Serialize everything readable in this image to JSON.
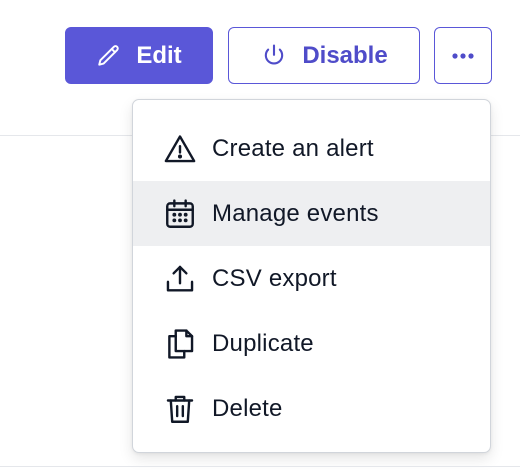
{
  "toolbar": {
    "edit_label": "Edit",
    "disable_label": "Disable",
    "more_label": "•••",
    "edit_icon": "pencil-icon",
    "disable_icon": "power-icon"
  },
  "menu": {
    "hovered_item": "Manage events",
    "items": [
      {
        "label": "Create an alert",
        "icon": "warning-triangle-icon"
      },
      {
        "label": "Manage events",
        "icon": "calendar-icon"
      },
      {
        "label": "CSV export",
        "icon": "upload-icon"
      },
      {
        "label": "Duplicate",
        "icon": "duplicate-icon"
      },
      {
        "label": "Delete",
        "icon": "trash-icon"
      }
    ]
  },
  "colors": {
    "primary": "#5a57d8",
    "primary_text": "#4f4cc9",
    "hover_bg": "#eeeff1",
    "text": "#111827"
  }
}
